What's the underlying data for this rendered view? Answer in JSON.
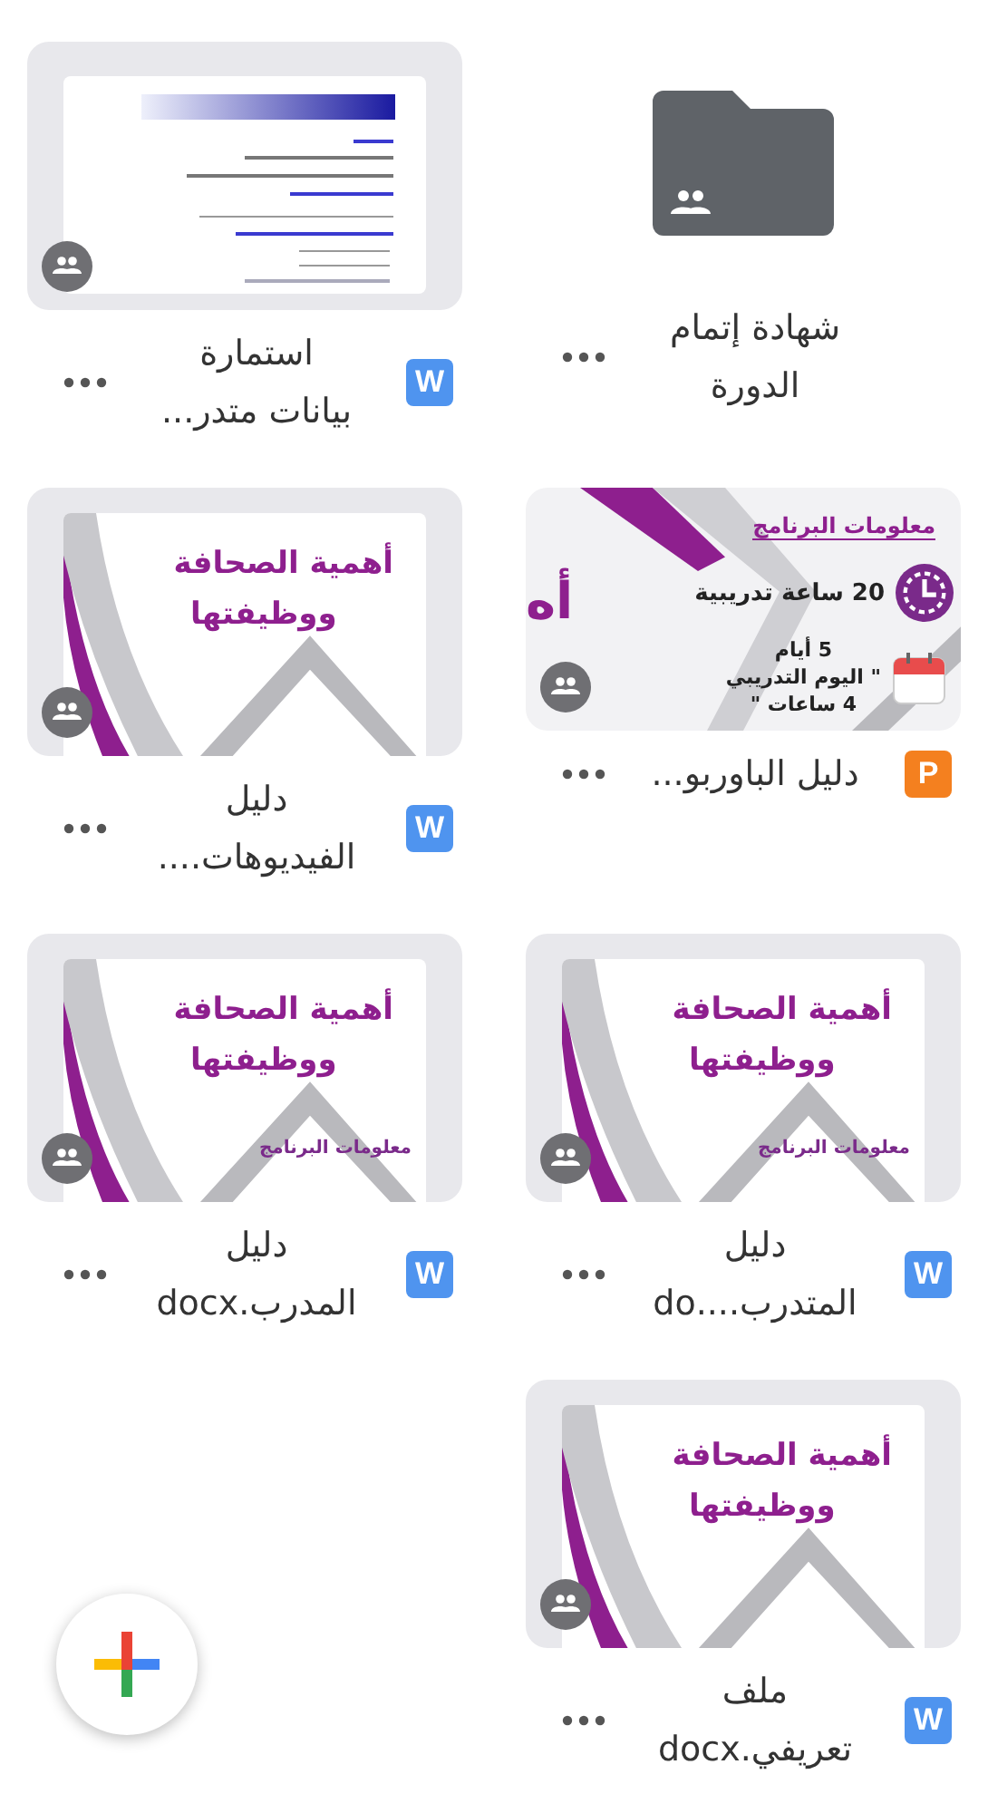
{
  "files": [
    {
      "kind": "folder",
      "shared": true,
      "name_lines": [
        "شهادة إتمام",
        "الدورة"
      ]
    },
    {
      "kind": "file",
      "shared": true,
      "type_badge": {
        "kind": "word",
        "letter": "W"
      },
      "name_lines": [
        "استمارة",
        "بيانات متدر..."
      ],
      "preview": {
        "kind": "form"
      }
    },
    {
      "kind": "file",
      "shared": true,
      "type_badge": {
        "kind": "powerpoint",
        "letter": "P"
      },
      "name_lines": [
        "دليل الباوربو..."
      ],
      "preview": {
        "kind": "program",
        "heading": "معلومات البرنامج",
        "hours": "20 ساعة تدريبية",
        "days": "5 أيام",
        "day_lines": [
          "\" اليوم التدريبي",
          "4 ساعات \""
        ],
        "cut_title": "أه"
      }
    },
    {
      "kind": "file",
      "shared": true,
      "type_badge": {
        "kind": "word",
        "letter": "W"
      },
      "name_lines": [
        "دليل",
        "الفيديوهات...."
      ],
      "preview": {
        "kind": "slide",
        "title_lines": [
          "أهمية الصحافة",
          "ووظيفتها"
        ]
      }
    },
    {
      "kind": "file",
      "shared": true,
      "type_badge": {
        "kind": "word",
        "letter": "W"
      },
      "name_lines": [
        "دليل",
        "المتدرب....do"
      ],
      "preview": {
        "kind": "slide",
        "title_lines": [
          "أهمية الصحافة",
          "ووظيفتها"
        ],
        "footer": "معلومات البرنامج"
      }
    },
    {
      "kind": "file",
      "shared": true,
      "type_badge": {
        "kind": "word",
        "letter": "W"
      },
      "name_lines": [
        "دليل",
        "المدرب.docx"
      ],
      "preview": {
        "kind": "slide",
        "title_lines": [
          "أهمية الصحافة",
          "ووظيفتها"
        ],
        "footer": "معلومات البرنامج"
      }
    },
    {
      "kind": "file",
      "shared": true,
      "type_badge": {
        "kind": "word",
        "letter": "W"
      },
      "name_lines": [
        "ملف",
        "تعريفي.docx"
      ],
      "preview": {
        "kind": "slide",
        "title_lines": [
          "أهمية الصحافة",
          "ووظيفتها"
        ]
      }
    }
  ]
}
